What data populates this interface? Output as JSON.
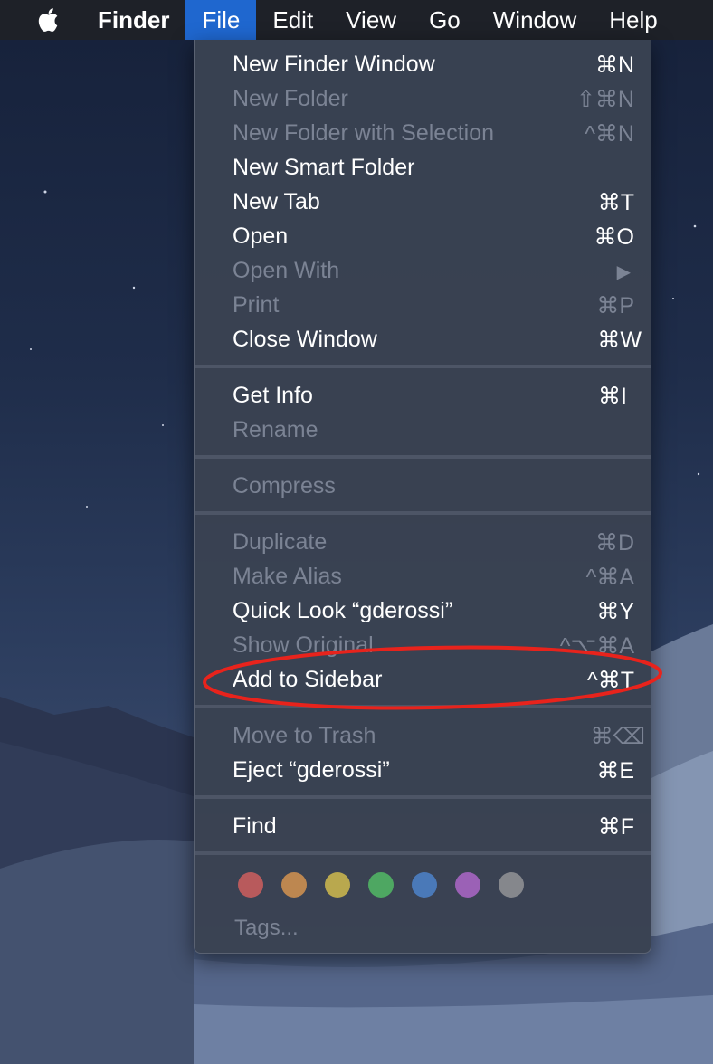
{
  "menubar": {
    "apple_icon": "apple-logo-icon",
    "app_name": "Finder",
    "menus": [
      "File",
      "Edit",
      "View",
      "Go",
      "Window",
      "Help"
    ]
  },
  "file_menu": {
    "items": [
      {
        "label": "New Finder Window",
        "shortcut": "⌘N",
        "enabled": true
      },
      {
        "label": "New Folder",
        "shortcut": "⇧⌘N",
        "enabled": false
      },
      {
        "label": "New Folder with Selection",
        "shortcut": "^⌘N",
        "enabled": false
      },
      {
        "label": "New Smart Folder",
        "shortcut": "",
        "enabled": true
      },
      {
        "label": "New Tab",
        "shortcut": "⌘T",
        "enabled": true
      },
      {
        "label": "Open",
        "shortcut": "⌘O",
        "enabled": true
      },
      {
        "label": "Open With",
        "shortcut": "▶",
        "enabled": false
      },
      {
        "label": "Print",
        "shortcut": "⌘P",
        "enabled": false
      },
      {
        "label": "Close Window",
        "shortcut": "⌘W",
        "enabled": true
      },
      {
        "label": "Get Info",
        "shortcut": "⌘I",
        "enabled": true
      },
      {
        "label": "Rename",
        "shortcut": "",
        "enabled": false
      },
      {
        "label": "Compress",
        "shortcut": "",
        "enabled": false
      },
      {
        "label": "Duplicate",
        "shortcut": "⌘D",
        "enabled": false
      },
      {
        "label": "Make Alias",
        "shortcut": "^⌘A",
        "enabled": false
      },
      {
        "label": "Quick Look “gderossi”",
        "shortcut": "⌘Y",
        "enabled": true
      },
      {
        "label": "Show Original",
        "shortcut": "^⌥⌘A",
        "enabled": false
      },
      {
        "label": "Add to Sidebar",
        "shortcut": "^⌘T",
        "enabled": true
      },
      {
        "label": "Move to Trash",
        "shortcut": "⌘⌫",
        "enabled": false
      },
      {
        "label": "Eject “gderossi”",
        "shortcut": "⌘E",
        "enabled": true
      },
      {
        "label": "Find",
        "shortcut": "⌘F",
        "enabled": true
      }
    ],
    "tag_colors": [
      {
        "name": "Red",
        "color": "#b85a5c"
      },
      {
        "name": "Orange",
        "color": "#bd8750"
      },
      {
        "name": "Yellow",
        "color": "#b9a84e"
      },
      {
        "name": "Green",
        "color": "#4ea762"
      },
      {
        "name": "Blue",
        "color": "#4a79b8"
      },
      {
        "name": "Purple",
        "color": "#9b61b6"
      },
      {
        "name": "Gray",
        "color": "#85878c"
      }
    ],
    "tags_label": "Tags..."
  },
  "annotation": {
    "color": "#e8231c"
  }
}
